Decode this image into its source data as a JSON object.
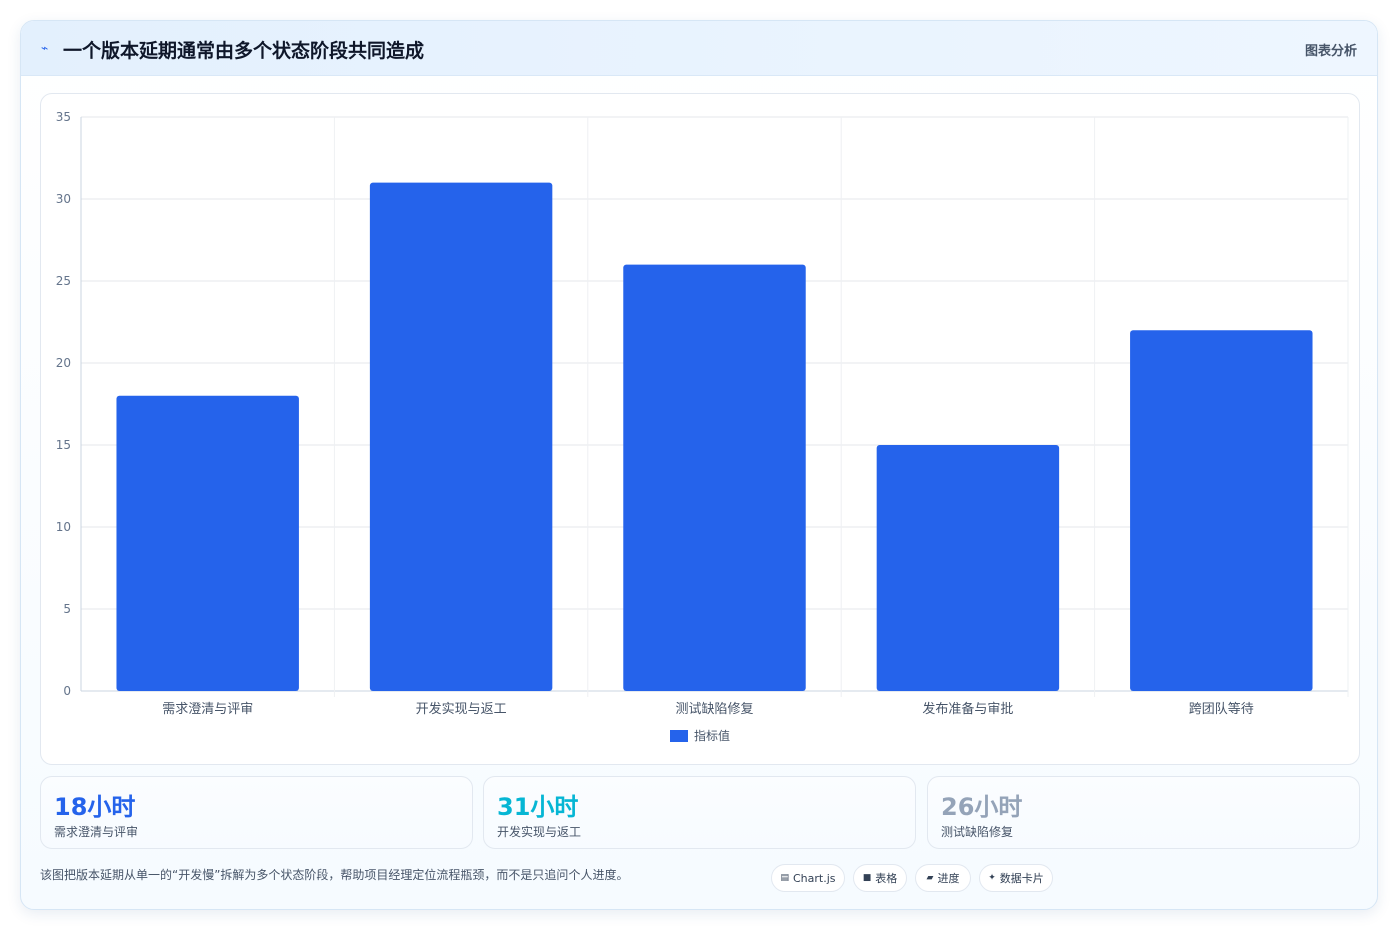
{
  "header": {
    "icon": "lightning-icon",
    "title": "一个版本延期通常由多个状态阶段共同造成",
    "tag": "图表分析"
  },
  "chart_data": {
    "type": "bar",
    "categories": [
      "需求澄清与评审",
      "开发实现与返工",
      "测试缺陷修复",
      "发布准备与审批",
      "跨团队等待"
    ],
    "series": [
      {
        "name": "指标值",
        "values": [
          18,
          31,
          26,
          15,
          22
        ],
        "color": "#2563eb"
      }
    ],
    "xlabel": "",
    "ylabel": "",
    "ylim": [
      0,
      35
    ],
    "yticks": [
      0,
      5,
      10,
      15,
      20,
      25,
      30,
      35
    ],
    "grid": true,
    "legend_position": "bottom"
  },
  "stats": [
    {
      "value": "18小时",
      "label": "需求澄清与评审",
      "color": "#2563eb"
    },
    {
      "value": "31小时",
      "label": "开发实现与返工",
      "color": "#06b6d4"
    },
    {
      "value": "26小时",
      "label": "测试缺陷修复",
      "color": "#94a3b8"
    }
  ],
  "footnote": "该图把版本延期从单一的“开发慢”拆解为多个状态阶段，帮助项目经理定位流程瓶颈，而不是只追问个人进度。",
  "chips": [
    {
      "icon": "chart-icon",
      "glyph": "▤",
      "label": "Chart.js"
    },
    {
      "icon": "table-icon",
      "glyph": "■",
      "label": "表格"
    },
    {
      "icon": "progress-icon",
      "glyph": "▰",
      "label": "进度"
    },
    {
      "icon": "sparkle-icon",
      "glyph": "✦",
      "label": "数据卡片"
    }
  ]
}
